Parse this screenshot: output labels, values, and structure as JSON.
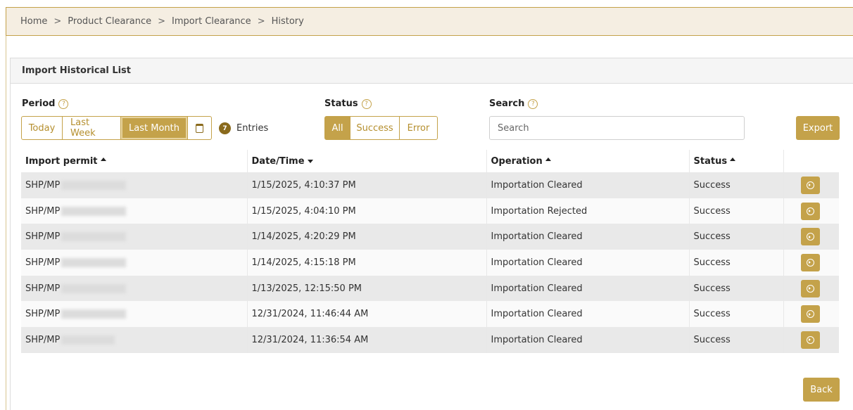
{
  "breadcrumb": {
    "home": "Home",
    "product_clearance": "Product Clearance",
    "import_clearance": "Import Clearance",
    "history": "History",
    "separator": ">"
  },
  "panel": {
    "title": "Import Historical List"
  },
  "filters": {
    "period_label": "Period",
    "period_options": [
      "Today",
      "Last Week",
      "Last Month"
    ],
    "period_selected": "Last Month",
    "entries_count": "7",
    "entries_label": "Entries",
    "status_label": "Status",
    "status_options": [
      "All",
      "Success",
      "Error"
    ],
    "status_selected": "All",
    "search_label": "Search",
    "search_placeholder": "Search",
    "search_value": ""
  },
  "buttons": {
    "export": "Export",
    "back": "Back"
  },
  "table": {
    "columns": [
      "Import permit",
      "Date/Time",
      "Operation",
      "Status"
    ],
    "rows": [
      {
        "permit": "SHP/MP",
        "datetime": "1/15/2025, 4:10:37 PM",
        "operation": "Importation Cleared",
        "status": "Success"
      },
      {
        "permit": "SHP/MP",
        "datetime": "1/15/2025, 4:04:10 PM",
        "operation": "Importation Rejected",
        "status": "Success"
      },
      {
        "permit": "SHP/MP",
        "datetime": "1/14/2025, 4:20:29 PM",
        "operation": "Importation Cleared",
        "status": "Success"
      },
      {
        "permit": "SHP/MP",
        "datetime": "1/14/2025, 4:15:18 PM",
        "operation": "Importation Cleared",
        "status": "Success"
      },
      {
        "permit": "SHP/MP",
        "datetime": "1/13/2025, 12:15:50 PM",
        "operation": "Importation Cleared",
        "status": "Success"
      },
      {
        "permit": "SHP/MP",
        "datetime": "12/31/2024, 11:46:44 AM",
        "operation": "Importation Cleared",
        "status": "Success"
      },
      {
        "permit": "SHP/MP",
        "datetime": "12/31/2024, 11:36:54 AM",
        "operation": "Importation Cleared",
        "status": "Success"
      }
    ]
  },
  "colors": {
    "accent": "#c4a24a",
    "accent_dark": "#8a6a1c",
    "breadcrumb_bg": "#f5eee2"
  }
}
